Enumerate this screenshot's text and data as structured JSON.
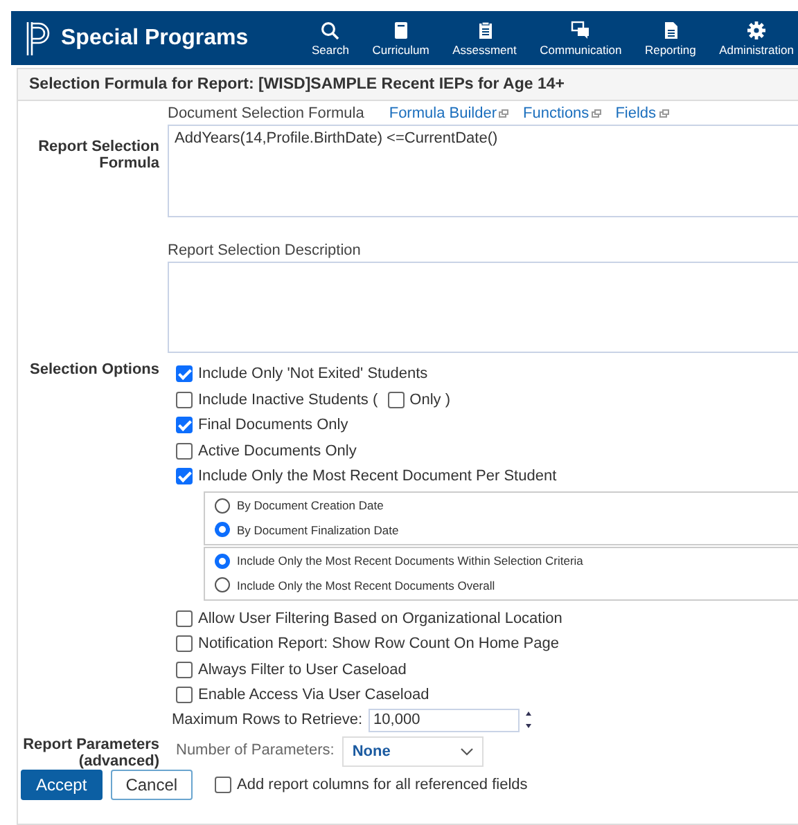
{
  "app": {
    "title": "Special Programs"
  },
  "nav": [
    {
      "label": "Search"
    },
    {
      "label": "Curriculum"
    },
    {
      "label": "Assessment"
    },
    {
      "label": "Communication"
    },
    {
      "label": "Reporting"
    },
    {
      "label": "Administration"
    }
  ],
  "panel": {
    "title": "Selection Formula for Report: [WISD]SAMPLE Recent IEPs for Age 14+"
  },
  "formula": {
    "label": "Report Selection Formula",
    "field_label": "Document Selection Formula",
    "links": [
      "Formula Builder",
      "Functions",
      "Fields"
    ],
    "value": "AddYears(14,Profile.BirthDate) <=CurrentDate()"
  },
  "description": {
    "field_label": "Report Selection Description"
  },
  "selection_options": {
    "label": "Selection Options",
    "options": [
      {
        "kind": "checkbox",
        "label": "Include Only 'Not Exited' Students",
        "checked": true
      },
      {
        "kind": "checkbox_pair",
        "label": "Include Inactive Students (",
        "checked": false,
        "sub_label": "Only )",
        "sub_checked": false
      },
      {
        "kind": "checkbox",
        "label": "Final Documents Only",
        "checked": true
      },
      {
        "kind": "checkbox",
        "label": "Active Documents Only",
        "checked": false
      },
      {
        "kind": "checkbox",
        "label": "Include Only the Most Recent Document Per Student",
        "checked": true
      }
    ],
    "radio_groups": [
      {
        "options": [
          {
            "label": "By Document Creation Date",
            "selected": false
          },
          {
            "label": "By Document Finalization Date",
            "selected": true
          }
        ]
      },
      {
        "options": [
          {
            "label": "Include Only the Most Recent Documents Within Selection Criteria",
            "selected": true
          },
          {
            "label": "Include Only the Most Recent Documents Overall",
            "selected": false
          }
        ]
      }
    ],
    "more_options": [
      {
        "label": "Allow User Filtering Based on Organizational Location",
        "checked": false
      },
      {
        "label": "Notification Report: Show Row Count On Home Page",
        "checked": false
      },
      {
        "label": "Always Filter to User Caseload",
        "checked": false
      },
      {
        "label": "Enable Access Via User Caseload",
        "checked": false
      }
    ],
    "max_rows": {
      "label": "Maximum Rows to Retrieve:",
      "value": "10,000"
    }
  },
  "parameters": {
    "label": "Report Parameters (advanced)",
    "field_label": "Number of Parameters:",
    "value": "None"
  },
  "buttons": [
    {
      "label": "Accept"
    },
    {
      "label": "Cancel"
    }
  ],
  "add_columns": {
    "label": "Add report columns for all referenced fields",
    "checked": false
  }
}
